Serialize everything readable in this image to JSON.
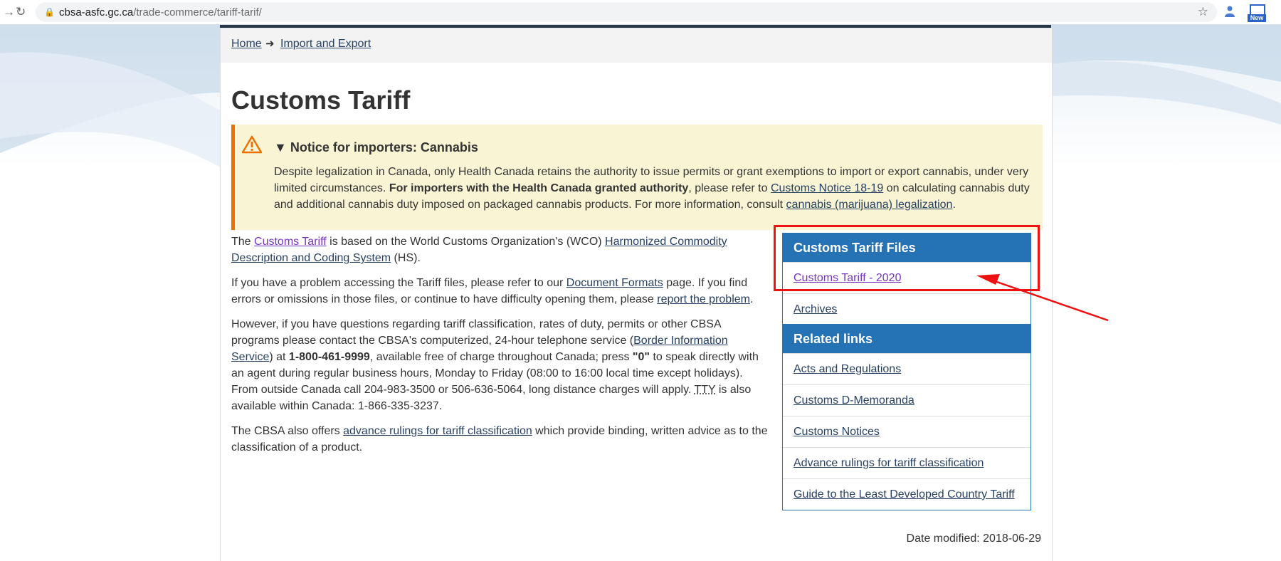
{
  "browser": {
    "url_host": "cbsa-asfc.gc.ca",
    "url_path": "/trade-commerce/tariff-tarif/",
    "extension_badge": "New"
  },
  "breadcrumb": {
    "home": "Home",
    "import_export": "Import and Export"
  },
  "page_title": "Customs Tariff",
  "notice": {
    "title": "Notice for importers: Cannabis",
    "text1": "Despite legalization in Canada, only Health Canada retains the authority to issue permits or grant exemptions to import or export cannabis, under very limited circumstances. ",
    "bold": "For importers with the Health Canada granted authority",
    "text2": ", please refer to ",
    "link1": "Customs Notice 18-19",
    "text3": " on calculating cannabis duty and additional cannabis duty imposed on packaged cannabis products. For more information, consult ",
    "link2": "cannabis (marijuana) legalization",
    "text4": "."
  },
  "content": {
    "p1": {
      "a": "The ",
      "link1": "Customs Tariff",
      "b": " is based on the World Customs Organization's (WCO) ",
      "link2": "Harmonized Commodity Description and Coding System",
      "c": " (HS)."
    },
    "p2": {
      "a": "If you have a problem accessing the Tariff files, please refer to our ",
      "link1": "Document Formats",
      "b": " page. If you find errors or omissions in those files, or continue to have difficulty opening them, please ",
      "link2": "report the problem",
      "c": "."
    },
    "p3": {
      "a": "However, if you have questions regarding tariff classification, rates of duty, permits or other CBSA programs please contact the CBSA's computerized, 24-hour telephone service (",
      "link1": "Border Information Service",
      "b": ") at ",
      "phone": "1-800-461-9999",
      "c": ", available free of charge throughout Canada; press ",
      "zero": "\"0\"",
      "d": " to speak directly with an agent during regular business hours, Monday to Friday (08:00 to 16:00 local time except holidays). From outside Canada call 204-983-3500 or 506-636-5064, long distance charges will apply. ",
      "tty": "TTY",
      "e": " is also available within Canada: 1-866-335-3237."
    },
    "p4": {
      "a": "The CBSA also offers ",
      "link1": "advance rulings for tariff classification",
      "b": " which provide binding, written advice as to the classification of a product."
    }
  },
  "tariff_files": {
    "title": "Customs Tariff Files",
    "items": [
      "Customs Tariff - 2020",
      "Archives"
    ]
  },
  "related_links": {
    "title": "Related links",
    "items": [
      "Acts and Regulations",
      "Customs D-Memoranda",
      "Customs Notices",
      "Advance rulings for tariff classification",
      "Guide to the Least Developed Country Tariff"
    ]
  },
  "date_modified": "Date modified: 2018-06-29",
  "colors": {
    "header_blue": "#2572b4",
    "link": "#284162",
    "visited_link": "#7834bc",
    "notice_bg": "#f9f4d4",
    "notice_border": "#ee7100",
    "annotation_red": "#ee1111"
  }
}
